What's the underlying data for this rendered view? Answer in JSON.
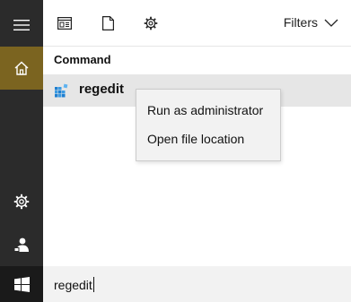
{
  "rail": {
    "menu_icon": "hamburger-icon",
    "home_icon": "home-icon",
    "settings_icon": "gear-icon",
    "user_icon": "user-icon",
    "start_icon": "windows-logo-icon",
    "accent_color": "#7b6420",
    "background_color": "#2b2b2b"
  },
  "toolbar": {
    "apps_icon": "apps-icon",
    "documents_icon": "document-icon",
    "settings_icon": "gear-icon",
    "filters_label": "Filters",
    "filters_icon": "chevron-down-icon"
  },
  "results": {
    "section_title": "Command",
    "items": [
      {
        "label": "regedit",
        "icon": "registry-editor-icon"
      }
    ]
  },
  "context_menu": {
    "items": [
      {
        "label": "Run as administrator"
      },
      {
        "label": "Open file location"
      }
    ]
  },
  "search": {
    "value": "regedit"
  }
}
